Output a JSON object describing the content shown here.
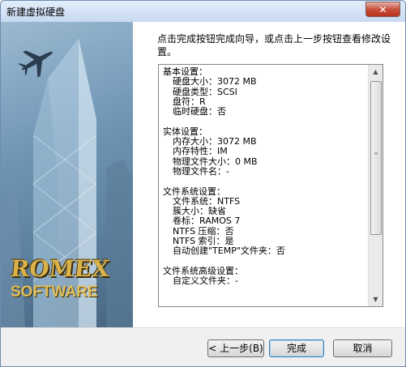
{
  "window": {
    "title": "新建虚拟硬盘",
    "close_glyph": "✕"
  },
  "sidebar": {
    "logo_top": "ROMEX",
    "logo_bottom": "SOFTWARE"
  },
  "instruction": "点击完成按钮完成向导，或点击上一步按钮查看修改设置。",
  "summary": [
    {
      "type": "head",
      "text": "基本设置："
    },
    {
      "type": "item",
      "text": "硬盘大小：3072 MB"
    },
    {
      "type": "item",
      "text": "硬盘类型：SCSI"
    },
    {
      "type": "item",
      "text": "盘符：R"
    },
    {
      "type": "item",
      "text": "临时硬盘：否"
    },
    {
      "type": "gap",
      "text": ""
    },
    {
      "type": "head",
      "text": "实体设置："
    },
    {
      "type": "item",
      "text": "内存大小：3072 MB"
    },
    {
      "type": "item",
      "text": "内存特性：IM"
    },
    {
      "type": "item",
      "text": "物理文件大小：0 MB"
    },
    {
      "type": "item",
      "text": "物理文件名：-"
    },
    {
      "type": "gap",
      "text": ""
    },
    {
      "type": "head",
      "text": "文件系统设置："
    },
    {
      "type": "item",
      "text": "文件系统：NTFS"
    },
    {
      "type": "item",
      "text": "簇大小：缺省"
    },
    {
      "type": "item",
      "text": "卷标：RAMOS 7"
    },
    {
      "type": "item",
      "text": "NTFS 压缩：否"
    },
    {
      "type": "item",
      "text": "NTFS 索引：是"
    },
    {
      "type": "item",
      "text": "自动创建\"TEMP\"文件夹：否"
    },
    {
      "type": "gap",
      "text": ""
    },
    {
      "type": "head",
      "text": "文件系统高级设置："
    },
    {
      "type": "item",
      "text": "自定义文件夹：-"
    }
  ],
  "scrollbar": {
    "up_glyph": "▲",
    "down_glyph": "▼",
    "grip_glyph": "≡"
  },
  "buttons": {
    "back": "< 上一步(B)",
    "finish": "完成",
    "cancel": "取消"
  },
  "colors": {
    "close_button": "#c7503c",
    "logo_gold": "#d9b24a"
  }
}
